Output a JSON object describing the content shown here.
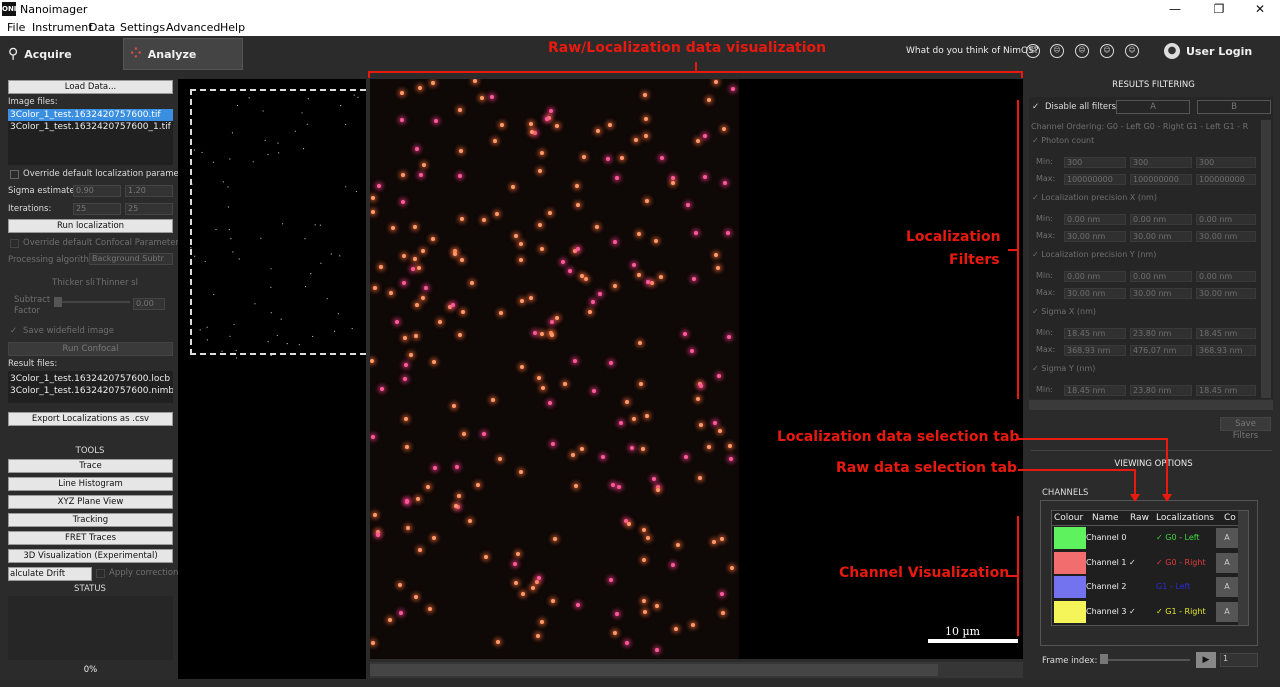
{
  "window": {
    "title": "Nanoimager",
    "logo": "ONI",
    "controls": [
      "—",
      "❐",
      "✕"
    ]
  },
  "menu": [
    "File",
    "Instrument",
    "Data",
    "Settings",
    "Advanced",
    "Help"
  ],
  "modes": [
    {
      "label": "Acquire",
      "icon": "ruler-icon"
    },
    {
      "label": "Analyze",
      "icon": "dots-icon"
    }
  ],
  "feedback": {
    "question": "What do you think of NimOS?",
    "faces": [
      "☹",
      "☹",
      "☹",
      "☺",
      "☺"
    ]
  },
  "user": {
    "label": "User Login"
  },
  "left": {
    "load_button": "Load Data...",
    "image_files_label": "Image files:",
    "image_files": [
      "3Color_1_test.1632420757600.tif",
      "3Color_1_test.1632420757600_1.tif"
    ],
    "override_loc": "Override default localization parameters",
    "sigma_label": "Sigma estimate:",
    "sigma_values": [
      "0.90",
      "1.20"
    ],
    "iter_label": "Iterations:",
    "iter_values": [
      "25",
      "25"
    ],
    "run_loc": "Run localization",
    "override_conf": "Override default Confocal Parameters",
    "proc_label": "Processing algorithm",
    "proc_value": "Background Subtr",
    "thicker": "Thicker sli",
    "thinner": "Thinner sl",
    "subtract_label": "Subtract Factor",
    "subtract_value": "0.00",
    "save_widefield": "Save widefield image",
    "run_confocal": "Run Confocal",
    "result_label": "Result files:",
    "result_files": [
      "3Color_1_test.1632420757600.locb",
      "3Color_1_test.1632420757600.nimb"
    ],
    "export": "Export Localizations as .csv",
    "tools_label": "TOOLS",
    "tools": [
      "Trace",
      "Line Histogram",
      "XYZ Plane View",
      "Tracking",
      "FRET Traces",
      "3D Visualization (Experimental)"
    ],
    "drift": "alculate Drift Correctio",
    "apply": "Apply correction",
    "status_label": "STATUS",
    "progress": "0%"
  },
  "view": {
    "scale": "10 µm"
  },
  "filters": {
    "title": "RESULTS FILTERING",
    "disable_all": "Disable all filters",
    "tabs": [
      "A",
      "B"
    ],
    "channel_ordering": "Channel Ordering:   G0 - Left    G0 - Right    G1 - Left    G1 - R",
    "groups": [
      {
        "name": "Photon count",
        "min": [
          "300",
          "300",
          "300"
        ],
        "max": [
          "100000000",
          "100000000",
          "100000000"
        ]
      },
      {
        "name": "Localization precision X (nm)",
        "min": [
          "0.00 nm",
          "0.00 nm",
          "0.00 nm"
        ],
        "max": [
          "30.00 nm",
          "30.00 nm",
          "30.00 nm"
        ]
      },
      {
        "name": "Localization precision Y (nm)",
        "min": [
          "0.00 nm",
          "0.00 nm",
          "0.00 nm"
        ],
        "max": [
          "30.00 nm",
          "30.00 nm",
          "30.00 nm"
        ]
      },
      {
        "name": "Sigma X (nm)",
        "min": [
          "18.45 nm",
          "23.80 nm",
          "18.45 nm"
        ],
        "max": [
          "368.93 nm",
          "476.07 nm",
          "368.93 nm"
        ]
      },
      {
        "name": "Sigma Y (nm)",
        "min": [
          "18.45 nm",
          "23.80 nm",
          "18.45 nm"
        ],
        "max": []
      }
    ],
    "min_label": "Min:",
    "max_label": "Max:",
    "save": "Save Filters"
  },
  "viewing": {
    "title": "VIEWING OPTIONS",
    "channels_label": "CHANNELS",
    "headers": [
      "Colour",
      "Name",
      "Raw",
      "Localizations",
      "Co"
    ],
    "channels": [
      {
        "name": "Channel 0",
        "raw": "",
        "loc": "✓ G0 - Left",
        "color": "#5ef25e",
        "loc_color": "#3fd83f"
      },
      {
        "name": "Channel 1 ✓",
        "raw": "",
        "loc": "✓ G0 - Right",
        "color": "#f26e6e",
        "loc_color": "#e23c3c"
      },
      {
        "name": "Channel 2",
        "raw": "",
        "loc": "G1 - Left",
        "color": "#7373f0",
        "loc_color": "#2a2ad8"
      },
      {
        "name": "Channel 3 ✓",
        "raw": "",
        "loc": "✓ G1 - Right",
        "color": "#f5f55a",
        "loc_color": "#e6e62a"
      }
    ],
    "btn": "A",
    "frame_label": "Frame index:",
    "frame_value": "1"
  },
  "annotations": {
    "raw_loc": "Raw/Localization data visualization",
    "loc_filters_1": "Localization",
    "loc_filters_2": "Filters",
    "loc_tab": "Localization data selection tab",
    "raw_tab": "Raw data selection tab",
    "chan_vis": "Channel Visualization"
  }
}
